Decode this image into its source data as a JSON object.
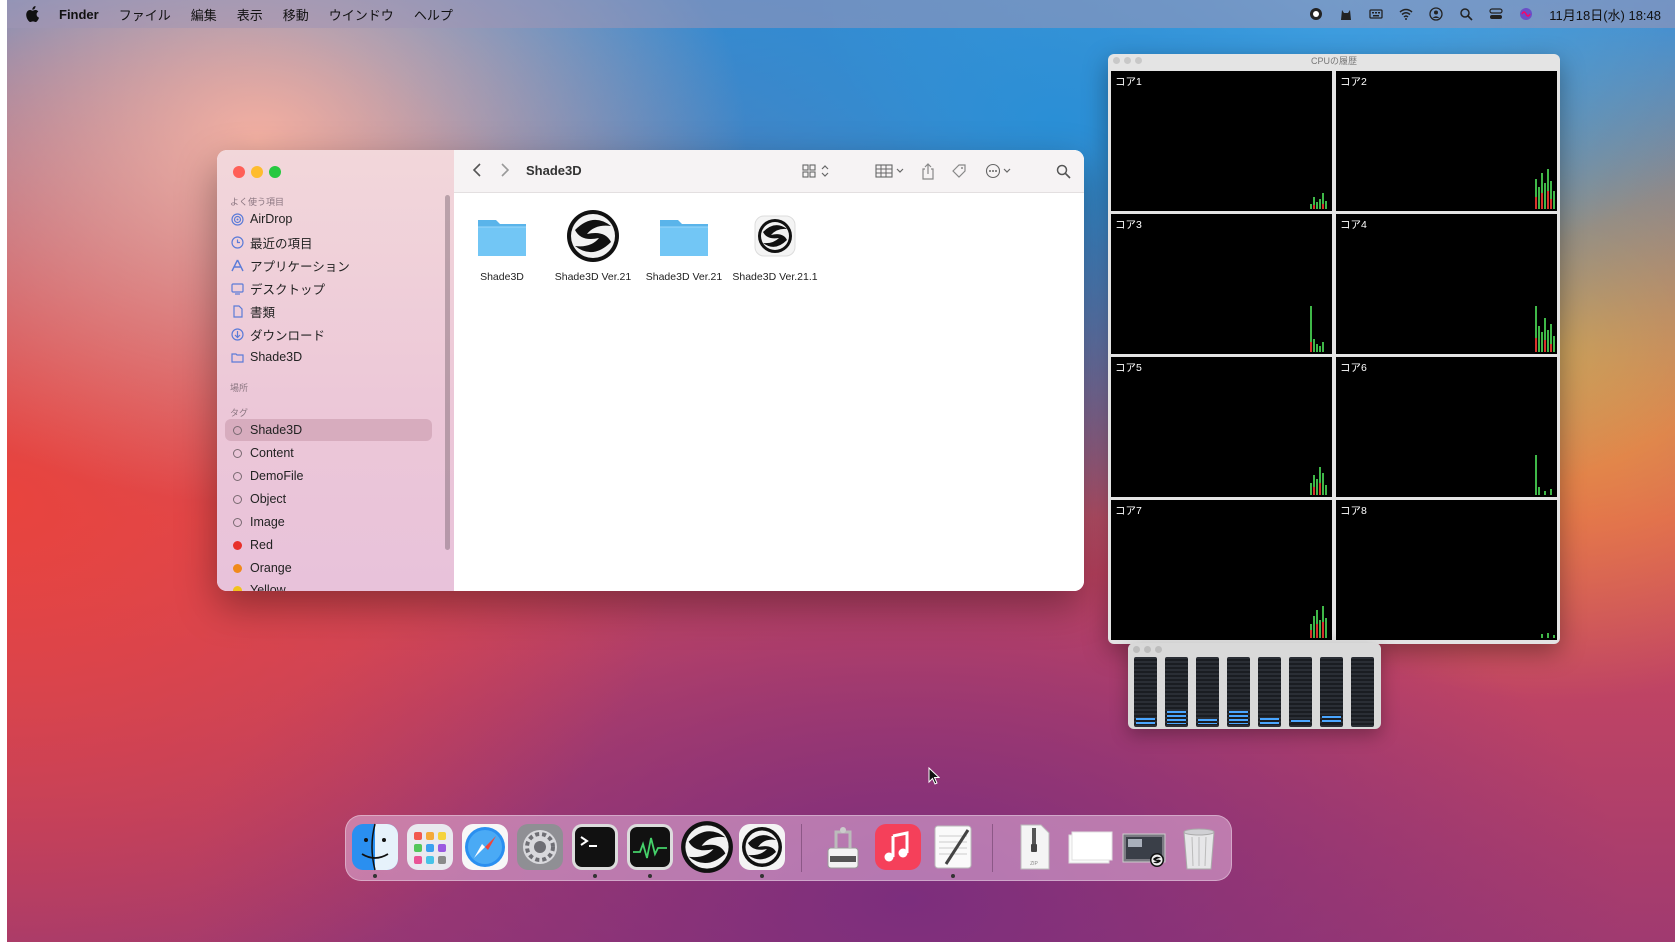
{
  "menubar": {
    "app_name": "Finder",
    "menus": [
      "ファイル",
      "編集",
      "表示",
      "移動",
      "ウインドウ",
      "ヘルプ"
    ],
    "clock": "11月18日(水)  18:48",
    "status_icons": [
      "screen-record-icon",
      "cat-icon",
      "keyboard-icon",
      "wifi-icon",
      "user-icon",
      "search-icon",
      "control-center-icon",
      "siri-icon"
    ]
  },
  "finder": {
    "title": "Shade3D",
    "sidebar": {
      "favorites_header": "よく使う項目",
      "favorites": [
        {
          "label": "AirDrop",
          "icon": "airdrop-icon"
        },
        {
          "label": "最近の項目",
          "icon": "clock-icon"
        },
        {
          "label": "アプリケーション",
          "icon": "applications-icon"
        },
        {
          "label": "デスクトップ",
          "icon": "desktop-icon"
        },
        {
          "label": "書類",
          "icon": "document-icon"
        },
        {
          "label": "ダウンロード",
          "icon": "download-icon"
        },
        {
          "label": "Shade3D",
          "icon": "folder-icon"
        }
      ],
      "locations_header": "場所",
      "tags_header": "タグ",
      "tags": [
        {
          "label": "Shade3D",
          "color": "",
          "selected": true
        },
        {
          "label": "Content",
          "color": ""
        },
        {
          "label": "DemoFile",
          "color": ""
        },
        {
          "label": "Object",
          "color": ""
        },
        {
          "label": "Image",
          "color": ""
        },
        {
          "label": "Red",
          "color": "#e8302a"
        },
        {
          "label": "Orange",
          "color": "#f08a1a"
        },
        {
          "label": "Yellow",
          "color": "#f2c21b"
        }
      ]
    },
    "files": [
      {
        "name": "Shade3D",
        "kind": "folder"
      },
      {
        "name": "Shade3D Ver.21",
        "kind": "app"
      },
      {
        "name": "Shade3D Ver.21",
        "kind": "folder"
      },
      {
        "name": "Shade3D Ver.21.1",
        "kind": "app-small"
      }
    ]
  },
  "cpu_history": {
    "title": "CPUの履歴",
    "cores": [
      "コア1",
      "コア2",
      "コア3",
      "コア4",
      "コア5",
      "コア6",
      "コア7",
      "コア8"
    ]
  },
  "cpu_usage": {
    "levels": [
      0.1,
      0.2,
      0.08,
      0.2,
      0.1,
      0.06,
      0.12,
      0.0
    ]
  },
  "dock": {
    "items": [
      {
        "name": "finder-icon",
        "running": true
      },
      {
        "name": "launchpad-icon",
        "running": false
      },
      {
        "name": "safari-icon",
        "running": false
      },
      {
        "name": "system-preferences-icon",
        "running": false
      },
      {
        "name": "terminal-icon",
        "running": true
      },
      {
        "name": "activity-monitor-icon",
        "running": true
      },
      {
        "name": "shade3d-icon",
        "running": false
      },
      {
        "name": "shade3d-ver21-1-icon",
        "running": true
      },
      {
        "name": "archive-utility-icon",
        "running": false
      },
      {
        "name": "music-icon",
        "running": false
      },
      {
        "name": "textedit-icon",
        "running": true
      },
      {
        "name": "zip-file-icon",
        "running": false
      },
      {
        "name": "blank-document-icon",
        "running": false
      },
      {
        "name": "screenshot-stack-icon",
        "running": false
      },
      {
        "name": "trash-icon",
        "running": false
      }
    ]
  }
}
